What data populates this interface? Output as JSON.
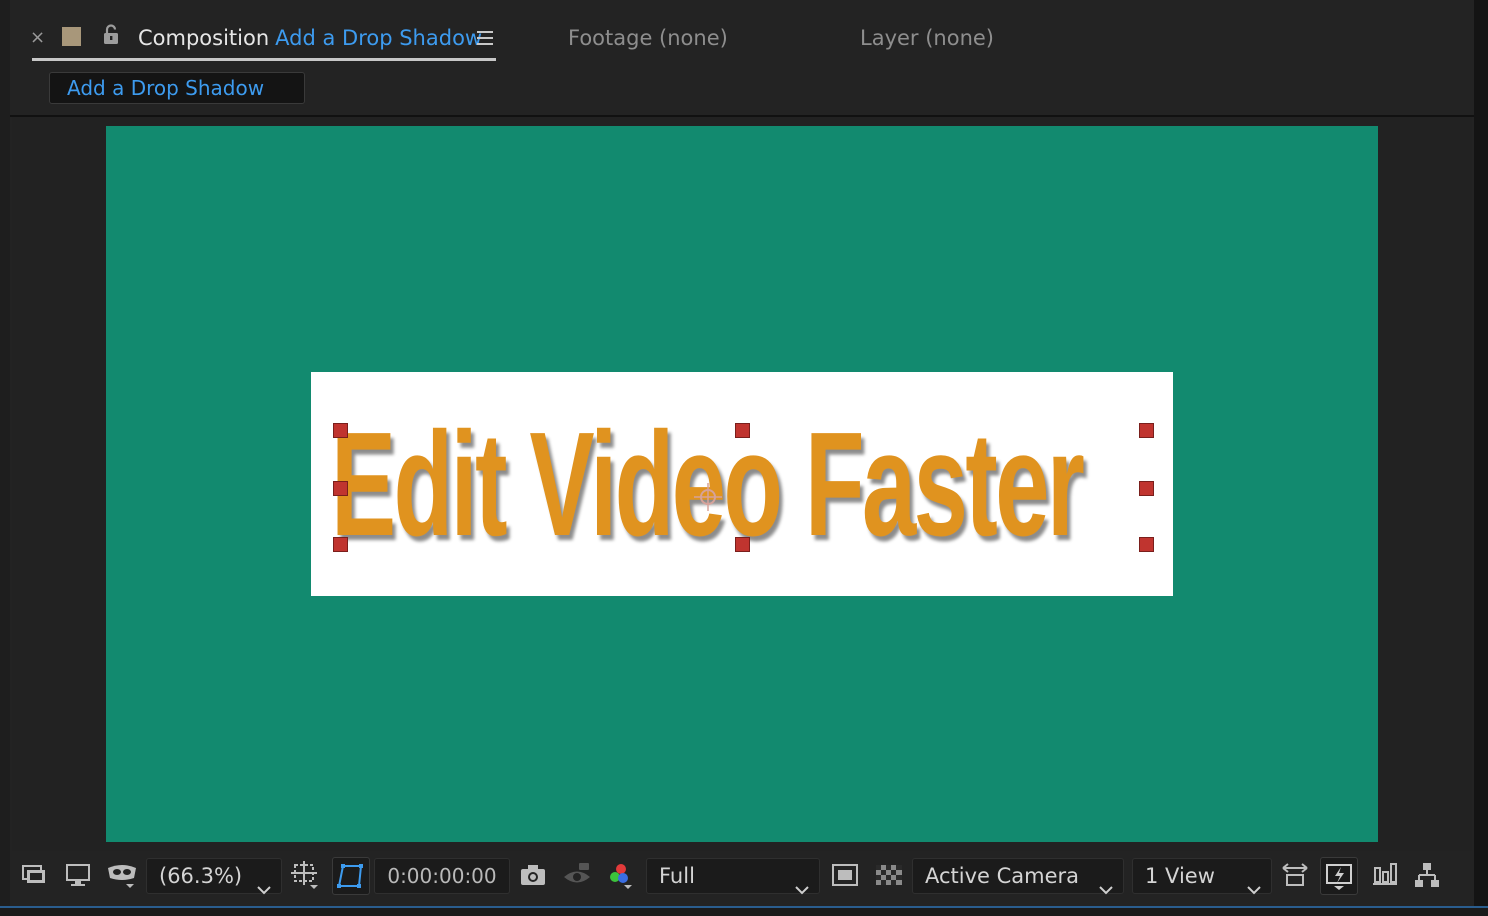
{
  "tabs": {
    "close_glyph": "×",
    "composition_label": "Composition",
    "composition_name": "Add a Drop Shadow",
    "footage_tab": "Footage (none)",
    "layer_tab": "Layer (none)"
  },
  "comp_flow": {
    "label": "Add a Drop Shadow"
  },
  "composition": {
    "background_color": "#128a6f",
    "text_layer": "Edit Video Faster",
    "text_color": "#e0931f",
    "box_color": "#ffffff",
    "handle_color": "#c0342f"
  },
  "toolbar": {
    "magnification": "(66.3%)",
    "timecode": "0:00:00:00",
    "resolution": "Full",
    "camera": "Active Camera",
    "view_layout": "1 View"
  },
  "icons": [
    "always-preview-icon",
    "monitor-icon",
    "mask-icon",
    "grid-icon",
    "region-of-interest-icon",
    "camera-snapshot-icon",
    "show-snapshot-icon",
    "color-channels-icon",
    "target-region-icon",
    "transparency-grid-icon",
    "reset-exposure-icon",
    "fast-previews-icon",
    "timeline-icon",
    "flowchart-icon"
  ],
  "accent_color": "#3d9bef"
}
